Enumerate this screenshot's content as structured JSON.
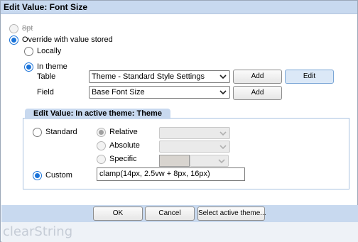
{
  "window": {
    "title": "Edit Value: Font Size"
  },
  "options": {
    "value_label": "8pt",
    "override_label": "Override with value stored",
    "locally_label": "Locally",
    "in_theme_label": "In theme"
  },
  "theme_source": {
    "table_label": "Table",
    "table_value": "Theme - Standard Style Settings",
    "field_label": "Field",
    "field_value": "Base Font Size",
    "add_label": "Add",
    "edit_label": "Edit",
    "field_add_label": "Add"
  },
  "active_theme": {
    "header": "Edit Value: In active theme: Theme",
    "standard_label": "Standard",
    "relative_label": "Relative",
    "absolute_label": "Absolute",
    "specific_label": "Specific",
    "custom_label": "Custom",
    "custom_value": "clamp(14px, 2.5vw + 8px, 16px)"
  },
  "footer": {
    "ok_label": "OK",
    "cancel_label": "Cancel",
    "select_theme_label": "Select active theme...",
    "brand": "clearString"
  },
  "colors": {
    "accent": "#1a73d9",
    "title_bar": "#c8d9ef"
  },
  "icons": {
    "dropdown": "chevron-down-icon"
  }
}
